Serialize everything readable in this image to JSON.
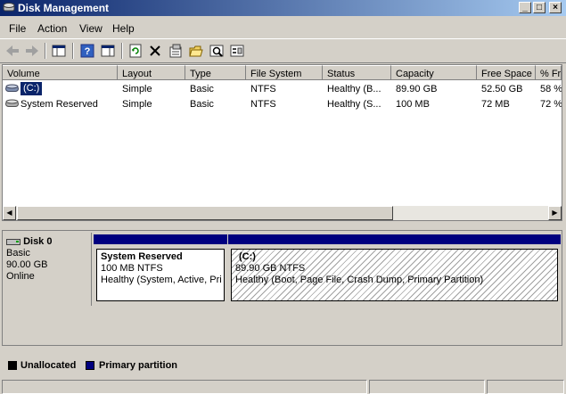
{
  "window": {
    "title": "Disk Management"
  },
  "menu": [
    "File",
    "Action",
    "View",
    "Help"
  ],
  "columns": [
    "Volume",
    "Layout",
    "Type",
    "File System",
    "Status",
    "Capacity",
    "Free Space",
    "% Fr"
  ],
  "volumes": [
    {
      "volume": "(C:)",
      "layout": "Simple",
      "type": "Basic",
      "fs": "NTFS",
      "status": "Healthy (B...",
      "capacity": "89.90 GB",
      "free": "52.50 GB",
      "pct": "58 %"
    },
    {
      "volume": "System Reserved",
      "layout": "Simple",
      "type": "Basic",
      "fs": "NTFS",
      "status": "Healthy (S...",
      "capacity": "100 MB",
      "free": "72 MB",
      "pct": "72 %"
    }
  ],
  "disk": {
    "name": "Disk 0",
    "type": "Basic",
    "size": "90.00 GB",
    "state": "Online"
  },
  "partitions": [
    {
      "name": "System Reserved",
      "size": "100 MB NTFS",
      "status": "Healthy (System, Active, Pri"
    },
    {
      "name": "(C:)",
      "size": "89.90 GB NTFS",
      "status": "Healthy (Boot, Page File, Crash Dump, Primary Partition)"
    }
  ],
  "legend": [
    "Unallocated",
    "Primary partition"
  ],
  "colors": {
    "title_start": "#0a246a",
    "title_end": "#a6caf0",
    "partition_bar": "#00007f",
    "selection": "#0a246a"
  },
  "icons": {
    "back": "back-arrow-icon",
    "forward": "forward-arrow-icon",
    "disk": "hard-disk-icon"
  }
}
